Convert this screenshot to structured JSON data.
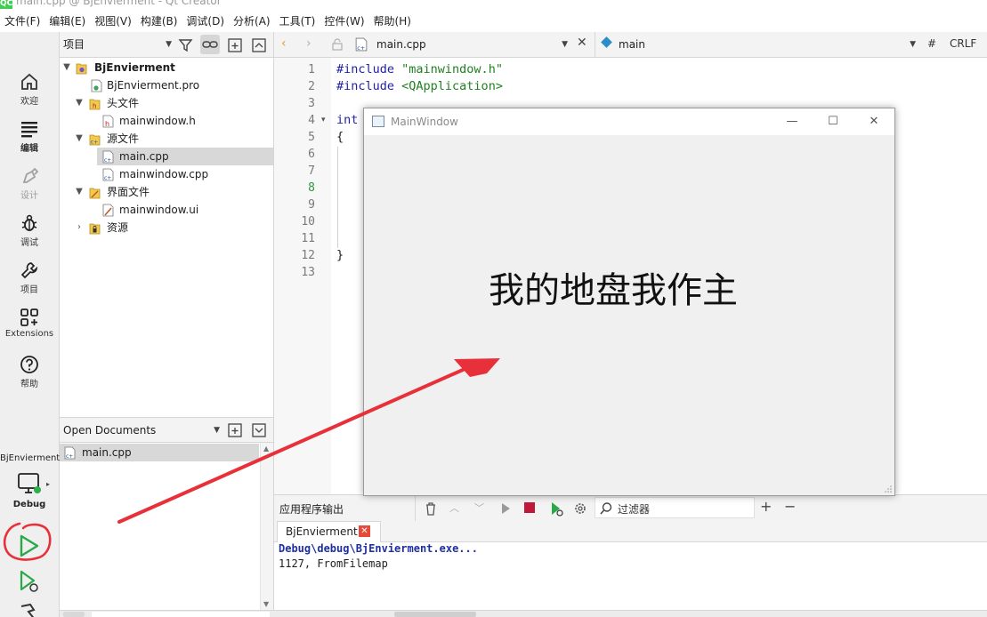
{
  "window": {
    "title": "main.cpp @ BjEnvierment - Qt Creator",
    "logo_text": "QC"
  },
  "menu": [
    "文件(F)",
    "编辑(E)",
    "视图(V)",
    "构建(B)",
    "调试(D)",
    "分析(A)",
    "工具(T)",
    "控件(W)",
    "帮助(H)"
  ],
  "modes": [
    {
      "label": "欢迎",
      "icon": "home-icon"
    },
    {
      "label": "编辑",
      "icon": "edit-icon"
    },
    {
      "label": "设计",
      "icon": "design-icon"
    },
    {
      "label": "调试",
      "icon": "bug-icon"
    },
    {
      "label": "项目",
      "icon": "wrench-icon"
    },
    {
      "label": "Extensions",
      "icon": "extensions-icon"
    },
    {
      "label": "帮助",
      "icon": "help-icon"
    }
  ],
  "kit": {
    "project": "BjEnvierment",
    "config": "Debug"
  },
  "project_pane": {
    "view_selector": "项目",
    "tree": [
      {
        "label": "BjEnvierment",
        "level": 0,
        "expanded": true,
        "type": "project"
      },
      {
        "label": "BjEnvierment.pro",
        "level": 1,
        "type": "pro"
      },
      {
        "label": "头文件",
        "level": 1,
        "expanded": true,
        "type": "folder-h"
      },
      {
        "label": "mainwindow.h",
        "level": 2,
        "type": "header"
      },
      {
        "label": "源文件",
        "level": 1,
        "expanded": true,
        "type": "folder-cpp"
      },
      {
        "label": "main.cpp",
        "level": 2,
        "type": "source",
        "selected": true
      },
      {
        "label": "mainwindow.cpp",
        "level": 2,
        "type": "source"
      },
      {
        "label": "界面文件",
        "level": 1,
        "expanded": true,
        "type": "folder-ui"
      },
      {
        "label": "mainwindow.ui",
        "level": 2,
        "type": "ui"
      },
      {
        "label": "资源",
        "level": 1,
        "expanded": false,
        "type": "folder-res"
      }
    ]
  },
  "open_documents": {
    "title": "Open Documents",
    "items": [
      "main.cpp"
    ]
  },
  "editor_toolbar": {
    "file": "main.cpp",
    "symbol": "main",
    "hash": "#",
    "line_ending": "CRLF"
  },
  "editor": {
    "line_numbers": [
      "1",
      "2",
      "3",
      "4",
      "5",
      "6",
      "7",
      "8",
      "9",
      "10",
      "11",
      "12",
      "13"
    ],
    "current_line": "8",
    "lines": [
      {
        "n": 1,
        "parts": [
          {
            "t": "#include ",
            "c": "kw"
          },
          {
            "t": "\"mainwindow.h\"",
            "c": "str"
          }
        ]
      },
      {
        "n": 2,
        "parts": [
          {
            "t": "#include ",
            "c": "kw"
          },
          {
            "t": "<QApplication>",
            "c": "str"
          }
        ]
      },
      {
        "n": 4,
        "parts": [
          {
            "t": "int",
            "c": "kw"
          }
        ]
      },
      {
        "n": 5,
        "parts": [
          {
            "t": "{",
            "c": "plain"
          }
        ]
      },
      {
        "n": 12,
        "parts": [
          {
            "t": "}",
            "c": "plain"
          }
        ]
      }
    ]
  },
  "output": {
    "pane_title": "应用程序输出",
    "filter_placeholder": "过滤器",
    "add_label": "+",
    "remove_label": "−",
    "tab": "BjEnvierment",
    "lines": [
      {
        "text": "Debug\\debug\\BjEnvierment.exe...",
        "style": "bold-blue"
      },
      {
        "text": "1127, FromFilemap",
        "style": "plain"
      }
    ]
  },
  "app_window": {
    "title": "MainWindow",
    "label": "我的地盘我作主",
    "min": "—",
    "max": "☐",
    "close": "✕"
  },
  "colors": {
    "annotation": "#e8303a",
    "selection": "#d8d8d8",
    "accent_green": "#2b9a3e"
  }
}
